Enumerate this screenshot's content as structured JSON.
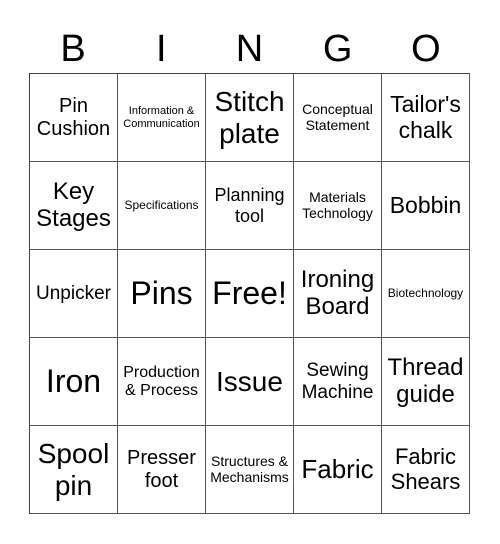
{
  "title_letters": [
    "B",
    "I",
    "N",
    "G",
    "O"
  ],
  "cells": [
    [
      "Pin Cushion",
      "Information & Communication",
      "Stitch plate",
      "Conceptual Statement",
      "Tailor's chalk"
    ],
    [
      "Key Stages",
      "Specifications",
      "Planning tool",
      "Materials Technology",
      "Bobbin"
    ],
    [
      "Unpicker",
      "Pins",
      "Free!",
      "Ironing Board",
      "Biotechnology"
    ],
    [
      "Iron",
      "Production & Process",
      "Issue",
      "Sewing Machine",
      "Thread guide"
    ],
    [
      "Spool pin",
      "Presser foot",
      "Structures & Mechanisms",
      "Fabric",
      "Fabric Shears"
    ]
  ]
}
